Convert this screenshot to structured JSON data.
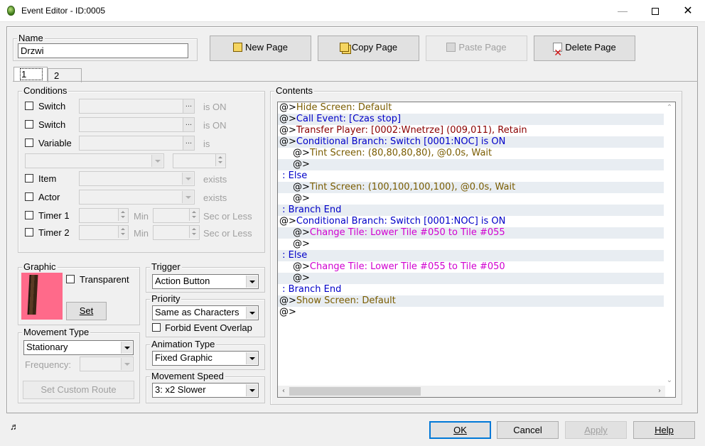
{
  "window": {
    "title": "Event Editor - ID:0005",
    "minimize_glyph": "—",
    "close_glyph": "✕"
  },
  "name_section": {
    "legend": "Name",
    "value": "Drzwi"
  },
  "page_buttons": {
    "new": "New Page",
    "copy": "Copy Page",
    "paste": "Paste Page",
    "delete": "Delete Page"
  },
  "tabs": [
    "1",
    "2"
  ],
  "conditions": {
    "legend": "Conditions",
    "switch1": {
      "label": "Switch",
      "suffix": "is ON"
    },
    "switch2": {
      "label": "Switch",
      "suffix": "is ON"
    },
    "variable": {
      "label": "Variable",
      "suffix": "is"
    },
    "item": {
      "label": "Item",
      "suffix": "exists"
    },
    "actor": {
      "label": "Actor",
      "suffix": "exists"
    },
    "timer1": {
      "label": "Timer 1",
      "min": "Min",
      "suffix": "Sec or Less"
    },
    "timer2": {
      "label": "Timer 2",
      "min": "Min",
      "suffix": "Sec or Less"
    },
    "dots": "..."
  },
  "graphic": {
    "legend": "Graphic",
    "transparent_label": "Transparent",
    "set_button": "Set"
  },
  "trigger": {
    "legend": "Trigger",
    "value": "Action Button"
  },
  "priority": {
    "legend": "Priority",
    "value": "Same as Characters",
    "forbid_label": "Forbid Event Overlap"
  },
  "animation": {
    "legend": "Animation Type",
    "value": "Fixed Graphic"
  },
  "movement_speed": {
    "legend": "Movement Speed",
    "value": "3: x2 Slower"
  },
  "movement_type": {
    "legend": "Movement Type",
    "value": "Stationary",
    "frequency_label": "Frequency:",
    "custom_route_button": "Set Custom Route"
  },
  "contents": {
    "legend": "Contents",
    "lines": [
      {
        "indent": 0,
        "prefix": "@>",
        "text": "Hide Screen: Default",
        "color": "#7a5c00"
      },
      {
        "indent": 0,
        "prefix": "@>",
        "text": "Call Event: [Czas stop]",
        "color": "#0000c8"
      },
      {
        "indent": 0,
        "prefix": "@>",
        "text": "Transfer Player: [0002:Wnetrze] (009,011), Retain",
        "color": "#8b0000"
      },
      {
        "indent": 0,
        "prefix": "@>",
        "text": "Conditional Branch: Switch [0001:NOC] is ON",
        "color": "#0000c8"
      },
      {
        "indent": 1,
        "prefix": "@>",
        "text": "Tint Screen: (80,80,80,80), @0.0s, Wait",
        "color": "#7a5c00"
      },
      {
        "indent": 1,
        "prefix": "@>",
        "text": "",
        "color": "#000000"
      },
      {
        "indent": 0,
        "prefix": " : ",
        "text": "Else",
        "color": "#0000c8"
      },
      {
        "indent": 1,
        "prefix": "@>",
        "text": "Tint Screen: (100,100,100,100), @0.0s, Wait",
        "color": "#7a5c00"
      },
      {
        "indent": 1,
        "prefix": "@>",
        "text": "",
        "color": "#000000"
      },
      {
        "indent": 0,
        "prefix": " : ",
        "text": "Branch End",
        "color": "#0000c8"
      },
      {
        "indent": 0,
        "prefix": "@>",
        "text": "Conditional Branch: Switch [0001:NOC] is ON",
        "color": "#0000c8"
      },
      {
        "indent": 1,
        "prefix": "@>",
        "text": "Change Tile: Lower Tile #050 to Tile #055",
        "color": "#d000d0"
      },
      {
        "indent": 1,
        "prefix": "@>",
        "text": "",
        "color": "#000000"
      },
      {
        "indent": 0,
        "prefix": " : ",
        "text": "Else",
        "color": "#0000c8"
      },
      {
        "indent": 1,
        "prefix": "@>",
        "text": "Change Tile: Lower Tile #055 to Tile #050",
        "color": "#d000d0"
      },
      {
        "indent": 1,
        "prefix": "@>",
        "text": "",
        "color": "#000000"
      },
      {
        "indent": 0,
        "prefix": " : ",
        "text": "Branch End",
        "color": "#0000c8"
      },
      {
        "indent": 0,
        "prefix": "@>",
        "text": "Show Screen: Default",
        "color": "#7a5c00"
      },
      {
        "indent": 0,
        "prefix": "@>",
        "text": "",
        "color": "#000000"
      }
    ]
  },
  "footer": {
    "ok": "OK",
    "cancel": "Cancel",
    "apply": "Apply",
    "help": "Help",
    "music_glyph": "♬"
  }
}
